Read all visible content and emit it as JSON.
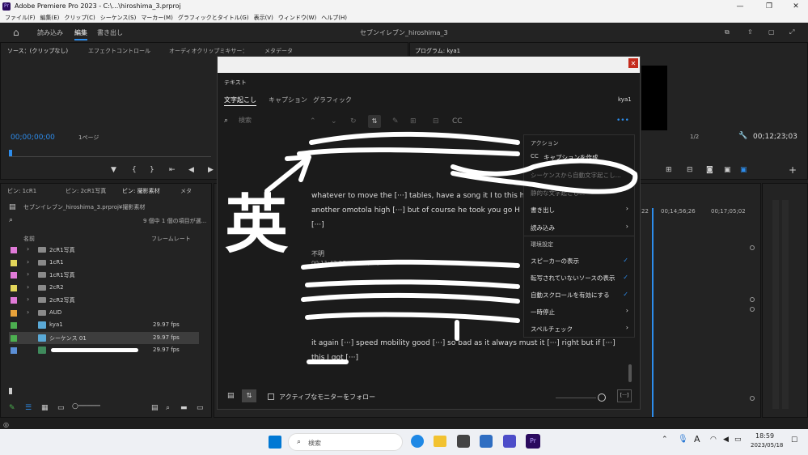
{
  "window": {
    "title": "Adobe Premiere Pro 2023 - C:\\...\\hiroshima_3.prproj",
    "app_icon": "Pr"
  },
  "menubar": [
    "ファイル(F)",
    "編集(E)",
    "クリップ(C)",
    "シーケンス(S)",
    "マーカー(M)",
    "グラフィックとタイトル(G)",
    "表示(V)",
    "ウィンドウ(W)",
    "ヘルプ(H)"
  ],
  "workspace": {
    "tabs": [
      "読み込み",
      "編集",
      "書き出し"
    ],
    "active": "編集",
    "project_title": "セブンイレブン_hiroshima_3"
  },
  "source_panel": {
    "tabs": [
      "ソース：(クリップなし)",
      "エフェクトコントロール",
      "オーディオクリップミキサー：",
      "メタデータ"
    ],
    "timecode": "00;00;00;00",
    "page_label": "1ページ"
  },
  "program_panel": {
    "tab": "プログラム: kya1",
    "timecode": "00;12;23;03",
    "zoom": "1/2"
  },
  "bins": {
    "tabs": [
      "ビン: 1cR1",
      "ビン: 2cR1写真",
      "ビン: 撮影素材",
      "メタ"
    ],
    "path": "セブンイレブン_hiroshima_3.prproj¥撮影素材",
    "count_text": "9 個中 1 個の項目が選...",
    "col_name": "名前",
    "col_rate": "フレームレート",
    "rows": [
      {
        "name": "2cR1写真",
        "color": "#e07ad8",
        "type": "folder",
        "fps": ""
      },
      {
        "name": "1cR1",
        "color": "#e3d65a",
        "type": "folder",
        "fps": ""
      },
      {
        "name": "1cR1写真",
        "color": "#e07ad8",
        "type": "folder",
        "fps": ""
      },
      {
        "name": "2cR2",
        "color": "#e3d65a",
        "type": "folder",
        "fps": ""
      },
      {
        "name": "2cR2写真",
        "color": "#e07ad8",
        "type": "folder",
        "fps": ""
      },
      {
        "name": "AUD",
        "color": "#e8a23a",
        "type": "folder",
        "fps": ""
      },
      {
        "name": "kya1",
        "color": "#4caf50",
        "type": "seq",
        "fps": "29.97 fps"
      },
      {
        "name": "シーケンス 01",
        "color": "#4caf50",
        "type": "seq",
        "fps": "29.97 fps"
      },
      {
        "name": "",
        "color": "#5b8fd6",
        "type": "clip",
        "fps": "29.97 fps"
      }
    ]
  },
  "timeline": {
    "times": [
      "00;14;56;26",
      "00;17;05;02"
    ],
    "marker": "22"
  },
  "text_panel": {
    "title": "テキスト",
    "tabs": [
      "文字起こし",
      "キャプション",
      "グラフィック"
    ],
    "active_tab": "文字起こし",
    "sequence": "kya1",
    "search_placeholder": "検索",
    "speaker_label": "不明",
    "timestamp2": "00;11;42;27 - 00;12;23;03",
    "para1_lines": [
      "whatever to move the [···] tables, have a song it I to this ho",
      "another omotola high [···] but of course he took you go H",
      "[···]"
    ],
    "para2_lines": [
      "it again [···] speed mobility good [···] so bad as it always must it [···] right but if [···]",
      "this I got [···]"
    ],
    "follow_label": "アクティブなモニターをフォロー",
    "ellipsis_btn": "[···]"
  },
  "context_menu": {
    "section_action": "アクション",
    "create_captions": "キャプションを作成",
    "auto_transcribe": "シーケンスから自動文字起こし...",
    "reimport": "静的な文字起こし...",
    "export": "書き出し",
    "import": "読み込み",
    "section_settings": "環境設定",
    "show_speakers": "スピーカーの表示",
    "show_untranscribed": "転写されていないソースの表示",
    "auto_scroll": "自動スクロールを有効にする",
    "pause": "一時停止",
    "spellcheck": "スペルチェック"
  },
  "annotation": {
    "glyph": "英"
  },
  "taskbar": {
    "search_placeholder": "検索",
    "ime": "A",
    "time": "18:59",
    "date": "2023/05/18"
  }
}
